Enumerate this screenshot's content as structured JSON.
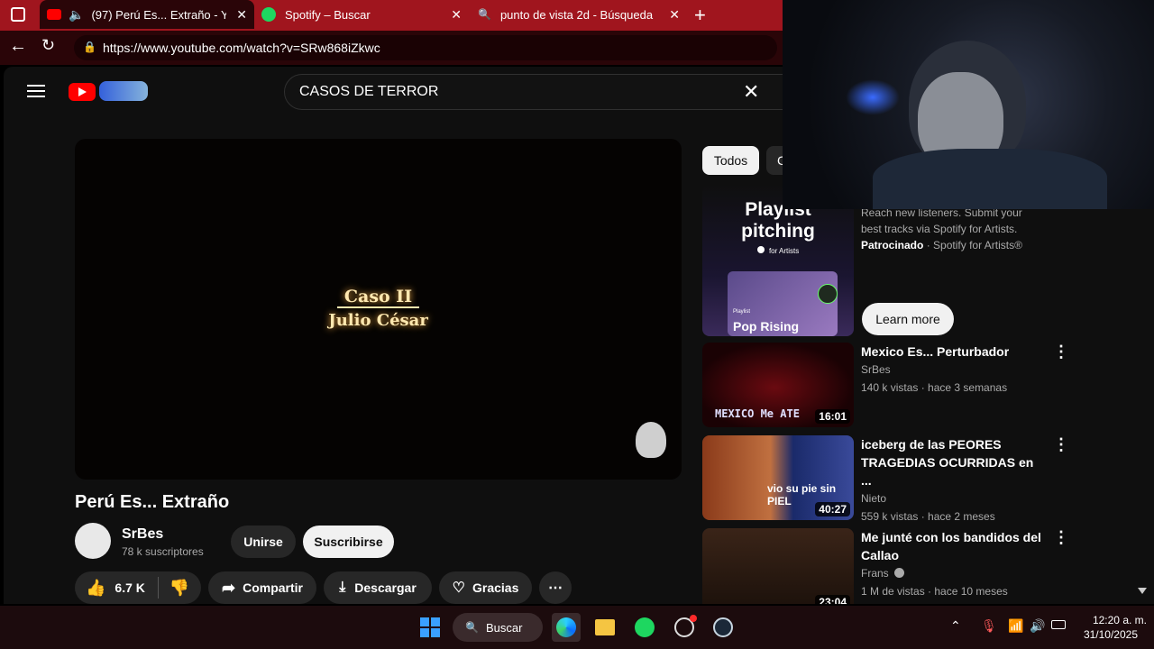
{
  "browser": {
    "tabs": [
      {
        "title": "(97) Perú Es... Extraño - YouTube",
        "active": true
      },
      {
        "title": "Spotify – Buscar",
        "active": false
      },
      {
        "title": "punto de vista 2d - Búsqueda",
        "active": false
      }
    ],
    "url": "https://www.youtube.com/watch?v=SRw868iZkwc"
  },
  "youtube": {
    "search_value": "CASOS DE TERROR",
    "video": {
      "overlay_line1": "Caso II",
      "overlay_line2": "Julio César",
      "title": "Perú Es... Extraño",
      "channel": "SrBes",
      "subscribers": "78 k suscriptores",
      "join_label": "Unirse",
      "subscribe_label": "Suscribirse",
      "likes": "6.7 K",
      "share_label": "Compartir",
      "download_label": "Descargar",
      "thanks_label": "Gracias"
    },
    "chips": [
      "Todos",
      "C"
    ],
    "ad": {
      "thumb_line1": "Playlist",
      "thumb_line2": "pitching",
      "thumb_brand": "for Artists",
      "thumb_playlist_tag": "Playlist",
      "thumb_playlist_name": "Pop Rising",
      "desc_line1": "Reach new listeners. Submit your",
      "desc_line2": "best tracks via Spotify for Artists.",
      "sponsored": "Patrocinado",
      "advertiser": "Spotify for Artists®",
      "cta": "Learn more"
    },
    "related": [
      {
        "title": "Mexico Es... Perturbador",
        "channel": "SrBes",
        "meta": "140 k vistas · hace 3 semanas",
        "duration": "16:01",
        "thumb_text": "MEXICO Me ATE"
      },
      {
        "title": "iceberg de las PEORES TRAGEDIAS OCURRIDAS en ...",
        "channel": "Nieto",
        "meta": "559 k vistas · hace 2 meses",
        "duration": "40:27",
        "thumb_text": "vio su pie sin PIEL"
      },
      {
        "title": "Me junté con los bandidos del Callao",
        "channel": "Frans",
        "meta": "1 M de vistas · hace 10 meses",
        "duration": "23:04",
        "thumb_text": ""
      }
    ]
  },
  "taskbar": {
    "search_label": "Buscar",
    "time": "12:20 a. m.",
    "date": "31/10/2025"
  },
  "colors": {
    "accent": "#a0151e",
    "yt_red": "#ff0000",
    "spotify": "#1ed760"
  }
}
